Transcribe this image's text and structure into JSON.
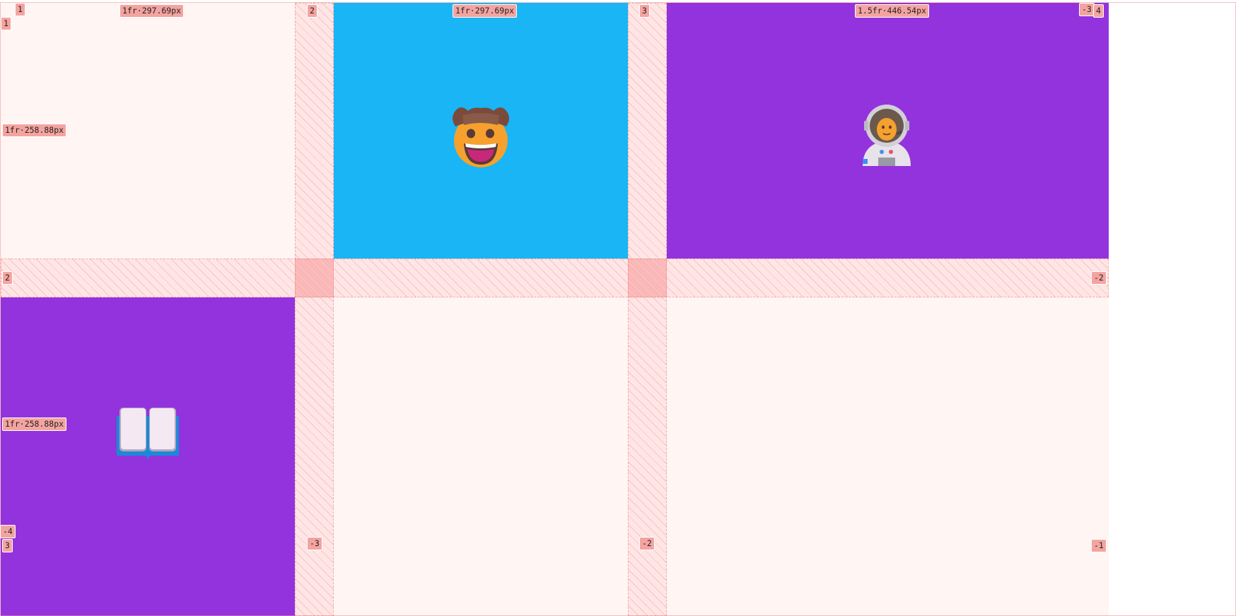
{
  "grid": {
    "column_track_labels": [
      "1fr·297.69px",
      "1fr·297.69px",
      "1.5fr·446.54px"
    ],
    "row_track_labels": [
      "1fr·258.88px",
      "1fr·258.88px"
    ],
    "column_line_labels_top": [
      "1",
      "2",
      "3",
      "4"
    ],
    "column_line_labels_bottom": [
      "-4",
      "-3",
      "-2",
      "-1"
    ],
    "column_line_label_top_right_extra": "-3",
    "row_line_labels_left": [
      "1",
      "2",
      "3"
    ],
    "row_line_labels_right": [
      "-2"
    ]
  },
  "cells": [
    {
      "name": "cell-empty",
      "background": "#fff5f3",
      "content": ""
    },
    {
      "name": "cell-cowboy",
      "background": "#19b5f5",
      "content": "cowboy-face-icon"
    },
    {
      "name": "cell-astronaut",
      "background": "#9333dd",
      "content": "astronaut-icon"
    },
    {
      "name": "cell-book",
      "background": "#9333dd",
      "content": "open-book-icon"
    },
    {
      "name": "cell-empty",
      "background": "#fff5f3",
      "content": ""
    },
    {
      "name": "cell-empty",
      "background": "#fff5f3",
      "content": ""
    }
  ],
  "colors": {
    "blue": "#19b5f5",
    "purple": "#9333dd",
    "cell_empty": "#fff5f3",
    "overlay_label": "#f4a4a0"
  }
}
